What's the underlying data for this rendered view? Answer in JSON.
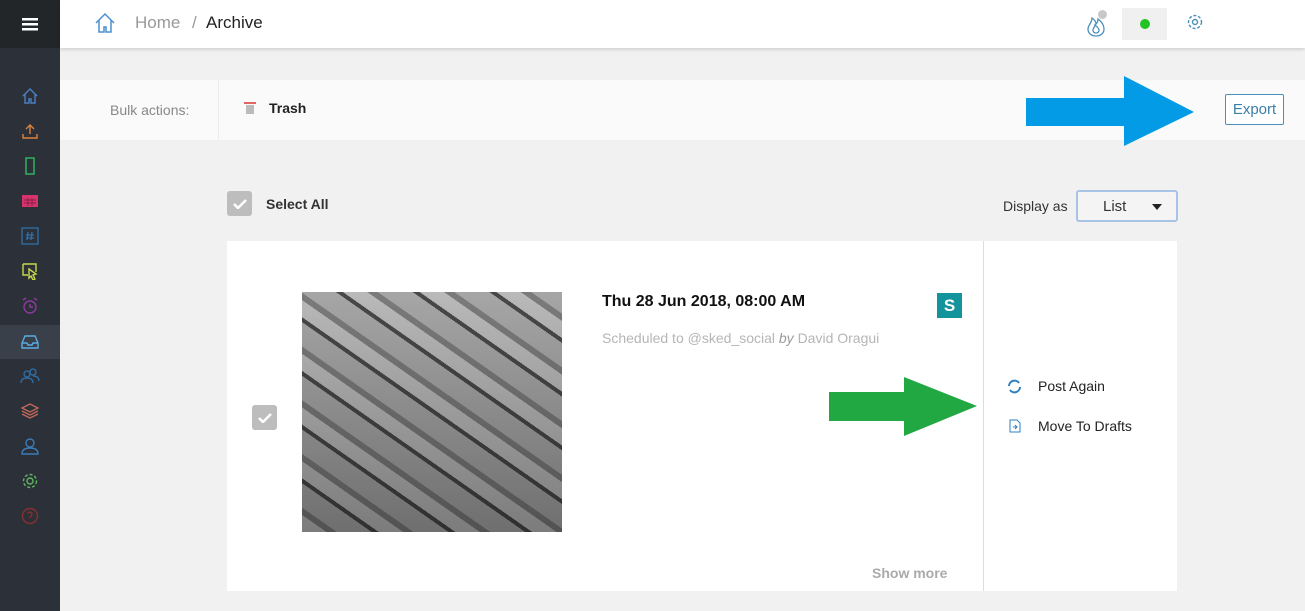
{
  "breadcrumb": {
    "home": "Home",
    "separator": "/",
    "current": "Archive"
  },
  "header": {
    "status_color": "#22c322"
  },
  "bulk": {
    "label": "Bulk actions:",
    "trash": "Trash",
    "export": "Export"
  },
  "list": {
    "select_all": "Select All",
    "display_as": "Display as",
    "display_value": "List"
  },
  "post": {
    "datetime": "Thu 28 Jun 2018, 08:00 AM",
    "badge": "S",
    "badge_color": "#13949c",
    "scheduled_prefix": "Scheduled to @sked_social",
    "by": "by",
    "author": "David Oragui",
    "show_more": "Show more",
    "actions": [
      "Post Again",
      "Move To Drafts"
    ]
  },
  "annotations": {
    "blue_arrow_color": "#039be5",
    "green_arrow_color": "#22a843"
  },
  "sidebar": {
    "icons": [
      "home-icon",
      "upload-icon",
      "phone-icon",
      "calendar-icon",
      "hashtag-icon",
      "cursor-icon",
      "alarm-icon",
      "inbox-icon",
      "users-icon",
      "layers-icon",
      "user-icon",
      "settings-icon",
      "help-icon"
    ],
    "active": "inbox-icon"
  }
}
